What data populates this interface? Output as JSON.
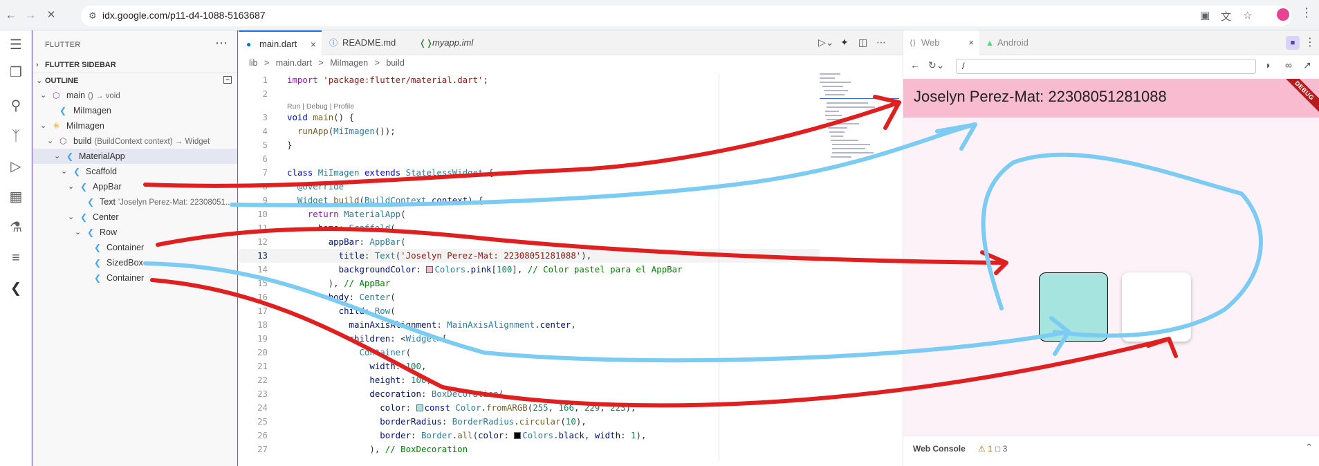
{
  "browser": {
    "url": "idx.google.com/p11-d4-1088-5163687",
    "back_icon": "←",
    "forward_icon": "→",
    "reload_icon": "✕"
  },
  "sidebar": {
    "title": "FLUTTER",
    "section_flutter_sidebar": "FLUTTER SIDEBAR",
    "section_outline": "OUTLINE",
    "tree": [
      {
        "label": "main",
        "detail": "() → void",
        "kind": "function"
      },
      {
        "label": "MiImagen",
        "detail": "",
        "kind": "widget"
      },
      {
        "label": "MiImagen",
        "detail": "",
        "kind": "class"
      },
      {
        "label": "build",
        "detail": "(BuildContext context) → Widget",
        "kind": "function"
      },
      {
        "label": "MaterialApp",
        "detail": "",
        "kind": "widget"
      },
      {
        "label": "Scaffold",
        "detail": "",
        "kind": "widget"
      },
      {
        "label": "AppBar",
        "detail": "",
        "kind": "widget"
      },
      {
        "label": "Text",
        "detail": "'Joselyn Perez-Mat: 22308051...",
        "kind": "widget"
      },
      {
        "label": "Center",
        "detail": "",
        "kind": "widget"
      },
      {
        "label": "Row",
        "detail": "",
        "kind": "widget"
      },
      {
        "label": "Container",
        "detail": "",
        "kind": "widget"
      },
      {
        "label": "SizedBox",
        "detail": "",
        "kind": "widget"
      },
      {
        "label": "Container",
        "detail": "",
        "kind": "widget"
      }
    ]
  },
  "editor": {
    "tabs": [
      {
        "label": "main.dart",
        "active": true
      },
      {
        "label": "README.md",
        "active": false
      },
      {
        "label": "myapp.iml",
        "active": false
      }
    ],
    "breadcrumb": [
      "lib",
      ">",
      "main.dart",
      ">",
      "MiImagen",
      ">",
      "build"
    ],
    "codelens": "Run | Debug | Profile",
    "current_line": "13",
    "line_numbers": [
      "1",
      "2",
      "3",
      "4",
      "5",
      "6",
      "7",
      "8",
      "9",
      "10",
      "11",
      "12",
      "13",
      "14",
      "15",
      "16",
      "17",
      "18",
      "19",
      "20",
      "21",
      "22",
      "23",
      "24",
      "25",
      "26",
      "27"
    ]
  },
  "preview": {
    "tabs": [
      {
        "label": "Web",
        "active": true
      },
      {
        "label": "Android",
        "active": false
      }
    ],
    "url": "/",
    "app_title": "Joselyn Perez-Mat: 22308051281088",
    "debug_banner": "DEBUG",
    "appbar_color": "#f8bbd0",
    "box1_color": "#a6e5df",
    "box2_color": "#ffffff",
    "web_console_label": "Web Console",
    "warning_count": "1",
    "message_count": "3"
  },
  "annotations": {
    "red_stroke_color": "#e02020",
    "blue_stroke_color": "#7ccbf2"
  }
}
